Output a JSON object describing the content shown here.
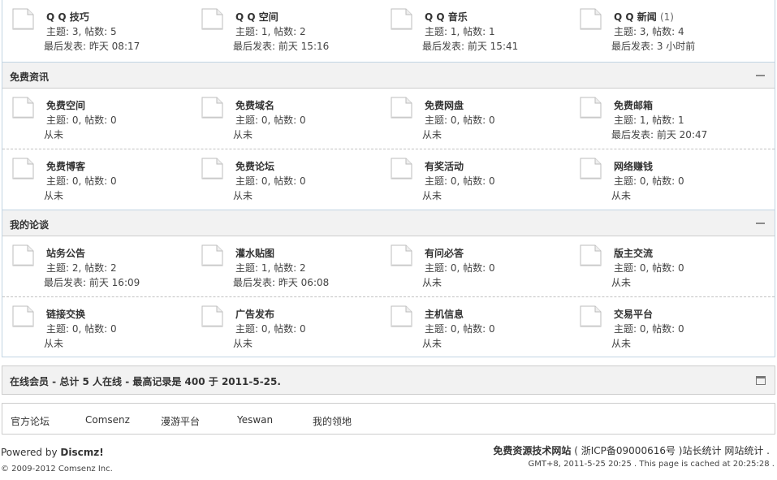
{
  "sections": [
    {
      "title": "",
      "rows": [
        [
          {
            "name": "Q Q 技巧",
            "new": "",
            "stats": "主题: 3, 帖数: 5",
            "last": "最后发表: 昨天 08:17"
          },
          {
            "name": "Q Q 空间",
            "new": "",
            "stats": "主题: 1, 帖数: 2",
            "last": "最后发表: 前天 15:16"
          },
          {
            "name": "Q Q 音乐",
            "new": "",
            "stats": "主题: 1, 帖数: 1",
            "last": "最后发表: 前天 15:41"
          },
          {
            "name": "Q Q 新闻",
            "new": "(1)",
            "stats": "主题: 3, 帖数: 4",
            "last": "最后发表: 3 小时前"
          }
        ]
      ]
    },
    {
      "title": "免费资讯",
      "rows": [
        [
          {
            "name": "免费空间",
            "new": "",
            "stats": "主题: 0, 帖数: 0",
            "last": "从未"
          },
          {
            "name": "免费域名",
            "new": "",
            "stats": "主题: 0, 帖数: 0",
            "last": "从未"
          },
          {
            "name": "免费网盘",
            "new": "",
            "stats": "主题: 0, 帖数: 0",
            "last": "从未"
          },
          {
            "name": "免费邮箱",
            "new": "",
            "stats": "主题: 1, 帖数: 1",
            "last": "最后发表: 前天 20:47"
          }
        ],
        [
          {
            "name": "免费博客",
            "new": "",
            "stats": "主题: 0, 帖数: 0",
            "last": "从未"
          },
          {
            "name": "免费论坛",
            "new": "",
            "stats": "主题: 0, 帖数: 0",
            "last": "从未"
          },
          {
            "name": "有奖活动",
            "new": "",
            "stats": "主题: 0, 帖数: 0",
            "last": "从未"
          },
          {
            "name": "网络赚钱",
            "new": "",
            "stats": "主题: 0, 帖数: 0",
            "last": "从未"
          }
        ]
      ]
    },
    {
      "title": "我的论谈",
      "rows": [
        [
          {
            "name": "站务公告",
            "new": "",
            "stats": "主题: 2, 帖数: 2",
            "last": "最后发表: 前天 16:09"
          },
          {
            "name": "灌水贴图",
            "new": "",
            "stats": "主题: 1, 帖数: 2",
            "last": "最后发表: 昨天 06:08"
          },
          {
            "name": "有问必答",
            "new": "",
            "stats": "主题: 0, 帖数: 0",
            "last": "从未"
          },
          {
            "name": "版主交流",
            "new": "",
            "stats": "主题: 0, 帖数: 0",
            "last": "从未"
          }
        ],
        [
          {
            "name": "链接交换",
            "new": "",
            "stats": "主题: 0, 帖数: 0",
            "last": "从未"
          },
          {
            "name": "广告发布",
            "new": "",
            "stats": "主题: 0, 帖数: 0",
            "last": "从未"
          },
          {
            "name": "主机信息",
            "new": "",
            "stats": "主题: 0, 帖数: 0",
            "last": "从未"
          },
          {
            "name": "交易平台",
            "new": "",
            "stats": "主题: 0, 帖数: 0",
            "last": "从未"
          }
        ]
      ]
    }
  ],
  "online": {
    "text": "在线会员 - 总计 5 人在线 - 最高记录是 400 于 2011-5-25."
  },
  "links": [
    "官方论坛",
    "Comsenz",
    "漫游平台",
    "Yeswan",
    "我的领地"
  ],
  "footer": {
    "powered_prefix": "Powered by ",
    "powered_name": "Discmz!",
    "copyright": "© 2009-2012 Comsenz Inc.",
    "site_name": "免费资源技术网站",
    "icp": "( 浙ICP备09000616号 )",
    "stat1": "站长统计",
    "stat2": "网站统计",
    "dot": ".",
    "gmt": "GMT+8, 2011-5-25 20:25 . This page is cached at 20:25:28 ."
  },
  "icons": {
    "forum": "forum-page-icon",
    "collapse": "collapse-icon",
    "online_toggle": "window-toggle-icon"
  },
  "colors": {
    "header_bg": "#f2f2f2",
    "border": "#c2d5e3",
    "text": "#333333"
  }
}
